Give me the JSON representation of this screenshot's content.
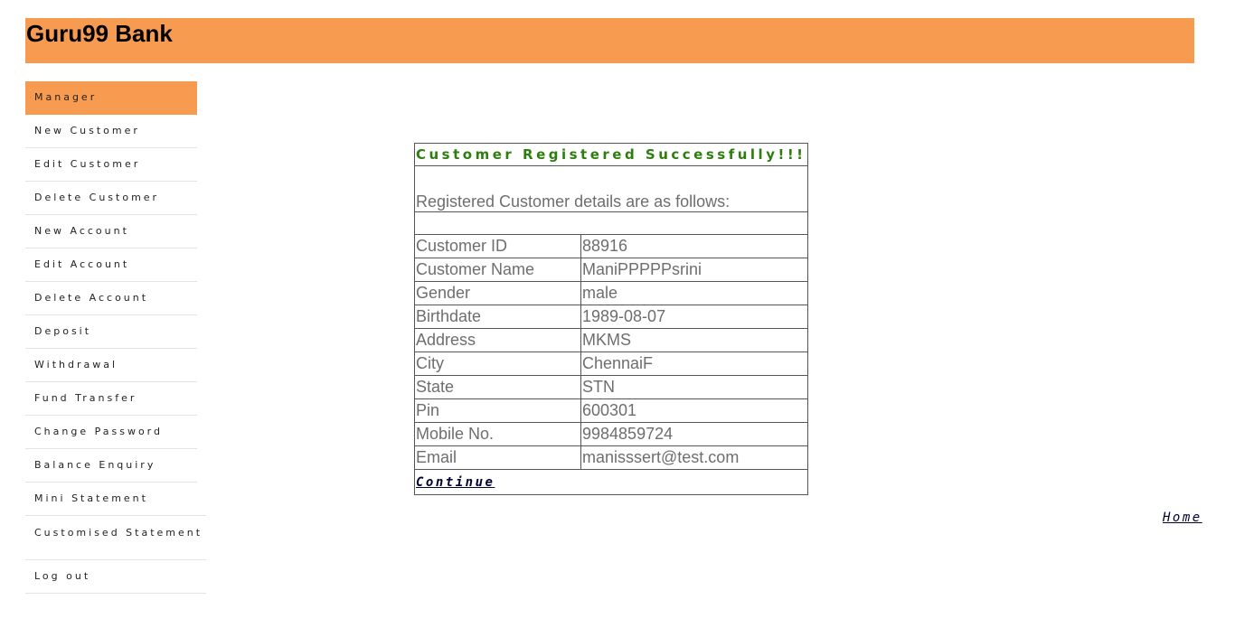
{
  "header": {
    "brand": "Guru99 Bank",
    "background": "#f79b51"
  },
  "sidebar": {
    "items": [
      {
        "label": "Manager",
        "active": true
      },
      {
        "label": "New Customer"
      },
      {
        "label": "Edit Customer"
      },
      {
        "label": "Delete Customer"
      },
      {
        "label": "New Account"
      },
      {
        "label": "Edit Account"
      },
      {
        "label": "Delete Account"
      },
      {
        "label": "Deposit"
      },
      {
        "label": "Withdrawal"
      },
      {
        "label": "Fund Transfer"
      },
      {
        "label": "Change Password"
      },
      {
        "label": "Balance Enquiry"
      },
      {
        "label": "Mini Statement"
      },
      {
        "label": "Customised Statement"
      },
      {
        "label": "Log out"
      }
    ]
  },
  "result": {
    "heading": "Customer Registered Successfully!!!",
    "heading_color": "#2e7d0f",
    "subheading": "Registered Customer details are as follows:",
    "rows": [
      {
        "label": "Customer ID",
        "value": "88916"
      },
      {
        "label": "Customer Name",
        "value": "ManiPPPPPsrini"
      },
      {
        "label": "Gender",
        "value": "male"
      },
      {
        "label": "Birthdate",
        "value": "1989-08-07"
      },
      {
        "label": "Address",
        "value": "MKMS"
      },
      {
        "label": "City",
        "value": "ChennaiF"
      },
      {
        "label": "State",
        "value": "STN"
      },
      {
        "label": "Pin",
        "value": "600301"
      },
      {
        "label": "Mobile No.",
        "value": "9984859724"
      },
      {
        "label": "Email",
        "value": "manisssert@test.com"
      }
    ],
    "continue_label": "Continue"
  },
  "footer": {
    "home_label": "Home"
  }
}
